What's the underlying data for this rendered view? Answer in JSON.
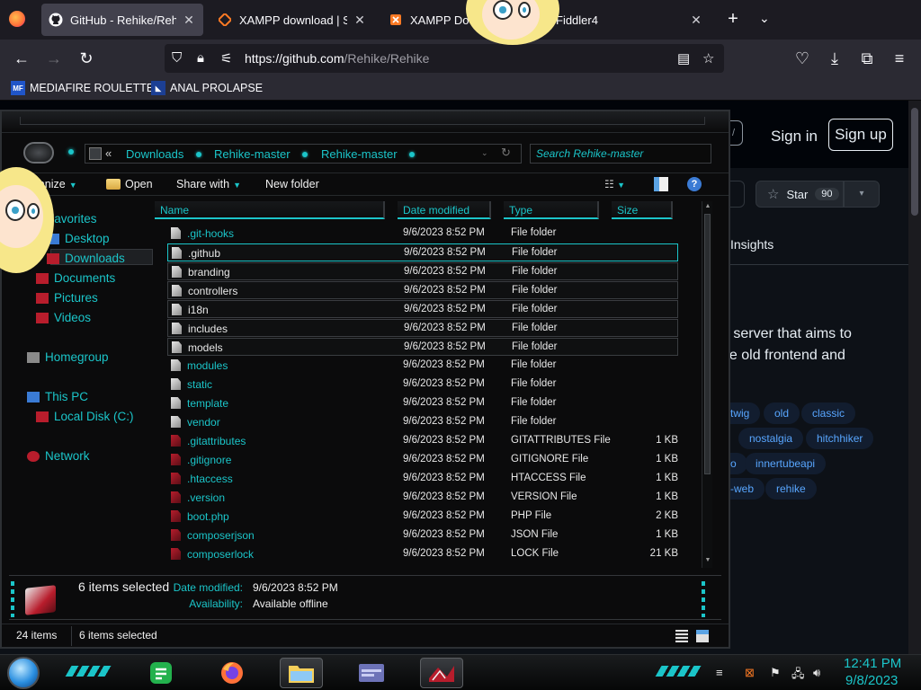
{
  "browser": {
    "tabs": [
      {
        "title": "GitHub - Rehike/Rehike",
        "icon": "github-icon",
        "active": true
      },
      {
        "title": "XAMPP download | Sour",
        "icon": "xampp-icon",
        "active": false
      },
      {
        "title": "XAMPP Dow",
        "icon": "xampp-icon",
        "active": false
      },
      {
        "title": "Fiddler4",
        "icon": "fiddler-icon",
        "active": false
      }
    ],
    "url_host": "https://github.com",
    "url_path": "/Rehike/Rehike",
    "bookmarks": [
      {
        "label": "MEDIAFIRE ROULETTER",
        "icon": "mediafire-icon"
      },
      {
        "label": "ANAL PROLAPSE",
        "icon": "bookmark-icon"
      }
    ]
  },
  "github": {
    "sign_in": "Sign in",
    "sign_up": "Sign up",
    "star_label": "Star",
    "star_count": "90",
    "insights_tab": "Insights",
    "description_lines": [
      "e server that aims to",
      "he old frontend and"
    ],
    "topics": [
      "twig",
      "old",
      "classic",
      "nostalgia",
      "hitchhiker",
      "o",
      "innertubeapi",
      "-web",
      "rehike"
    ]
  },
  "explorer": {
    "breadcrumb": [
      "Downloads",
      "Rehike-master",
      "Rehike-master"
    ],
    "breadcrumb_prefix": "«",
    "search_placeholder": "Search Rehike-master",
    "toolbar": {
      "organize": "Organize",
      "open": "Open",
      "share_with": "Share with",
      "new_folder": "New folder"
    },
    "nav": {
      "favorites": "Favorites",
      "desktop": "Desktop",
      "downloads": "Downloads",
      "documents": "Documents",
      "pictures": "Pictures",
      "videos": "Videos",
      "homegroup": "Homegroup",
      "this_pc": "This PC",
      "local_disk": "Local Disk (C:)",
      "network": "Network"
    },
    "columns": {
      "name": "Name",
      "date": "Date modified",
      "type": "Type",
      "size": "Size"
    },
    "files": [
      {
        "name": ".git-hooks",
        "date": "9/6/2023 8:52 PM",
        "type": "File folder",
        "size": "",
        "kind": "folder",
        "selected": false
      },
      {
        "name": ".github",
        "date": "9/6/2023 8:52 PM",
        "type": "File folder",
        "size": "",
        "kind": "folder",
        "selected": true
      },
      {
        "name": "branding",
        "date": "9/6/2023 8:52 PM",
        "type": "File folder",
        "size": "",
        "kind": "folder",
        "selected": true
      },
      {
        "name": "controllers",
        "date": "9/6/2023 8:52 PM",
        "type": "File folder",
        "size": "",
        "kind": "folder",
        "selected": true
      },
      {
        "name": "i18n",
        "date": "9/6/2023 8:52 PM",
        "type": "File folder",
        "size": "",
        "kind": "folder",
        "selected": true
      },
      {
        "name": "includes",
        "date": "9/6/2023 8:52 PM",
        "type": "File folder",
        "size": "",
        "kind": "folder",
        "selected": true
      },
      {
        "name": "models",
        "date": "9/6/2023 8:52 PM",
        "type": "File folder",
        "size": "",
        "kind": "folder",
        "selected": true
      },
      {
        "name": "modules",
        "date": "9/6/2023 8:52 PM",
        "type": "File folder",
        "size": "",
        "kind": "folder",
        "selected": false
      },
      {
        "name": "static",
        "date": "9/6/2023 8:52 PM",
        "type": "File folder",
        "size": "",
        "kind": "folder",
        "selected": false
      },
      {
        "name": "template",
        "date": "9/6/2023 8:52 PM",
        "type": "File folder",
        "size": "",
        "kind": "folder",
        "selected": false
      },
      {
        "name": "vendor",
        "date": "9/6/2023 8:52 PM",
        "type": "File folder",
        "size": "",
        "kind": "folder",
        "selected": false
      },
      {
        "name": ".gitattributes",
        "date": "9/6/2023 8:52 PM",
        "type": "GITATTRIBUTES File",
        "size": "1 KB",
        "kind": "file",
        "selected": false
      },
      {
        "name": ".gitignore",
        "date": "9/6/2023 8:52 PM",
        "type": "GITIGNORE File",
        "size": "1 KB",
        "kind": "file",
        "selected": false
      },
      {
        "name": ".htaccess",
        "date": "9/6/2023 8:52 PM",
        "type": "HTACCESS File",
        "size": "1 KB",
        "kind": "file",
        "selected": false
      },
      {
        "name": ".version",
        "date": "9/6/2023 8:52 PM",
        "type": "VERSION File",
        "size": "1 KB",
        "kind": "file",
        "selected": false
      },
      {
        "name": "boot.php",
        "date": "9/6/2023 8:52 PM",
        "type": "PHP File",
        "size": "2 KB",
        "kind": "file",
        "selected": false
      },
      {
        "name": "composerjson",
        "date": "9/6/2023 8:52 PM",
        "type": "JSON File",
        "size": "1 KB",
        "kind": "file",
        "selected": false
      },
      {
        "name": "composerlock",
        "date": "9/6/2023 8:52 PM",
        "type": "LOCK File",
        "size": "21 KB",
        "kind": "file",
        "selected": false
      }
    ],
    "details": {
      "count_text": "6 items selected",
      "date_label": "Date modified:",
      "date_value": "9/6/2023 8:52 PM",
      "avail_label": "Availability:",
      "avail_value": "Available offline"
    },
    "status": {
      "items": "24 items",
      "selected": "6 items selected"
    }
  },
  "taskbar": {
    "apps": [
      "notes-app-icon",
      "firefox-icon",
      "explorer-icon",
      "window-app-icon",
      "game-app-icon"
    ],
    "clock_time": "12:41 PM",
    "clock_date": "9/8/2023"
  },
  "colors": {
    "accent": "#1bc5c9",
    "file_icon": "#b81d2c",
    "github_link": "#58a6ff"
  }
}
